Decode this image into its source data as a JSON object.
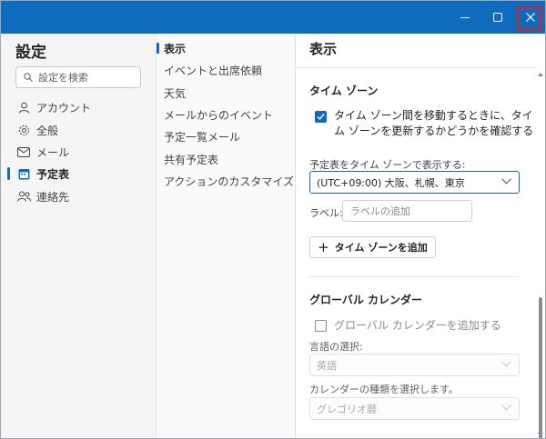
{
  "window": {
    "controls": {
      "minimize": "minimize-icon",
      "maximize": "maximize-icon",
      "close": "close-icon"
    },
    "accent_color": "#0f6cbd",
    "highlight_color": "#e01b24"
  },
  "left": {
    "title": "設定",
    "search_placeholder": "設定を検索",
    "nav": [
      {
        "label": "アカウント",
        "icon": "person-icon"
      },
      {
        "label": "全般",
        "icon": "gear-icon"
      },
      {
        "label": "メール",
        "icon": "mail-icon"
      },
      {
        "label": "予定表",
        "icon": "calendar-icon",
        "active": true
      },
      {
        "label": "連絡先",
        "icon": "people-icon"
      }
    ]
  },
  "middle": {
    "items": [
      {
        "label": "表示",
        "active": true
      },
      {
        "label": "イベントと出席依頼"
      },
      {
        "label": "天気"
      },
      {
        "label": "メールからのイベント"
      },
      {
        "label": "予定一覧メール"
      },
      {
        "label": "共有予定表"
      },
      {
        "label": "アクションのカスタマイズ"
      }
    ]
  },
  "right": {
    "header": "表示",
    "timezone": {
      "section_title": "タイム ゾーン",
      "update_checkbox": {
        "checked": true,
        "line1": "タイム ゾーン間を移動するときに、タイ",
        "line2": "ム ゾーンを更新するかどうかを確認する"
      },
      "display_label": "予定表をタイム ゾーンで表示する:",
      "display_value": "(UTC+09:00) 大阪、札幌、東京",
      "label_field": "ラベル:",
      "label_placeholder": "ラベルの追加",
      "add_button": "タイム ゾーンを追加"
    },
    "global_calendar": {
      "section_title": "グローバル カレンダー",
      "add_checkbox": {
        "checked": false,
        "label": "グローバル カレンダーを追加する"
      },
      "language_label": "言語の選択:",
      "language_value": "英語",
      "calendar_type_label": "カレンダーの種類を選択します。",
      "calendar_type_value": "グレゴリオ暦"
    }
  }
}
